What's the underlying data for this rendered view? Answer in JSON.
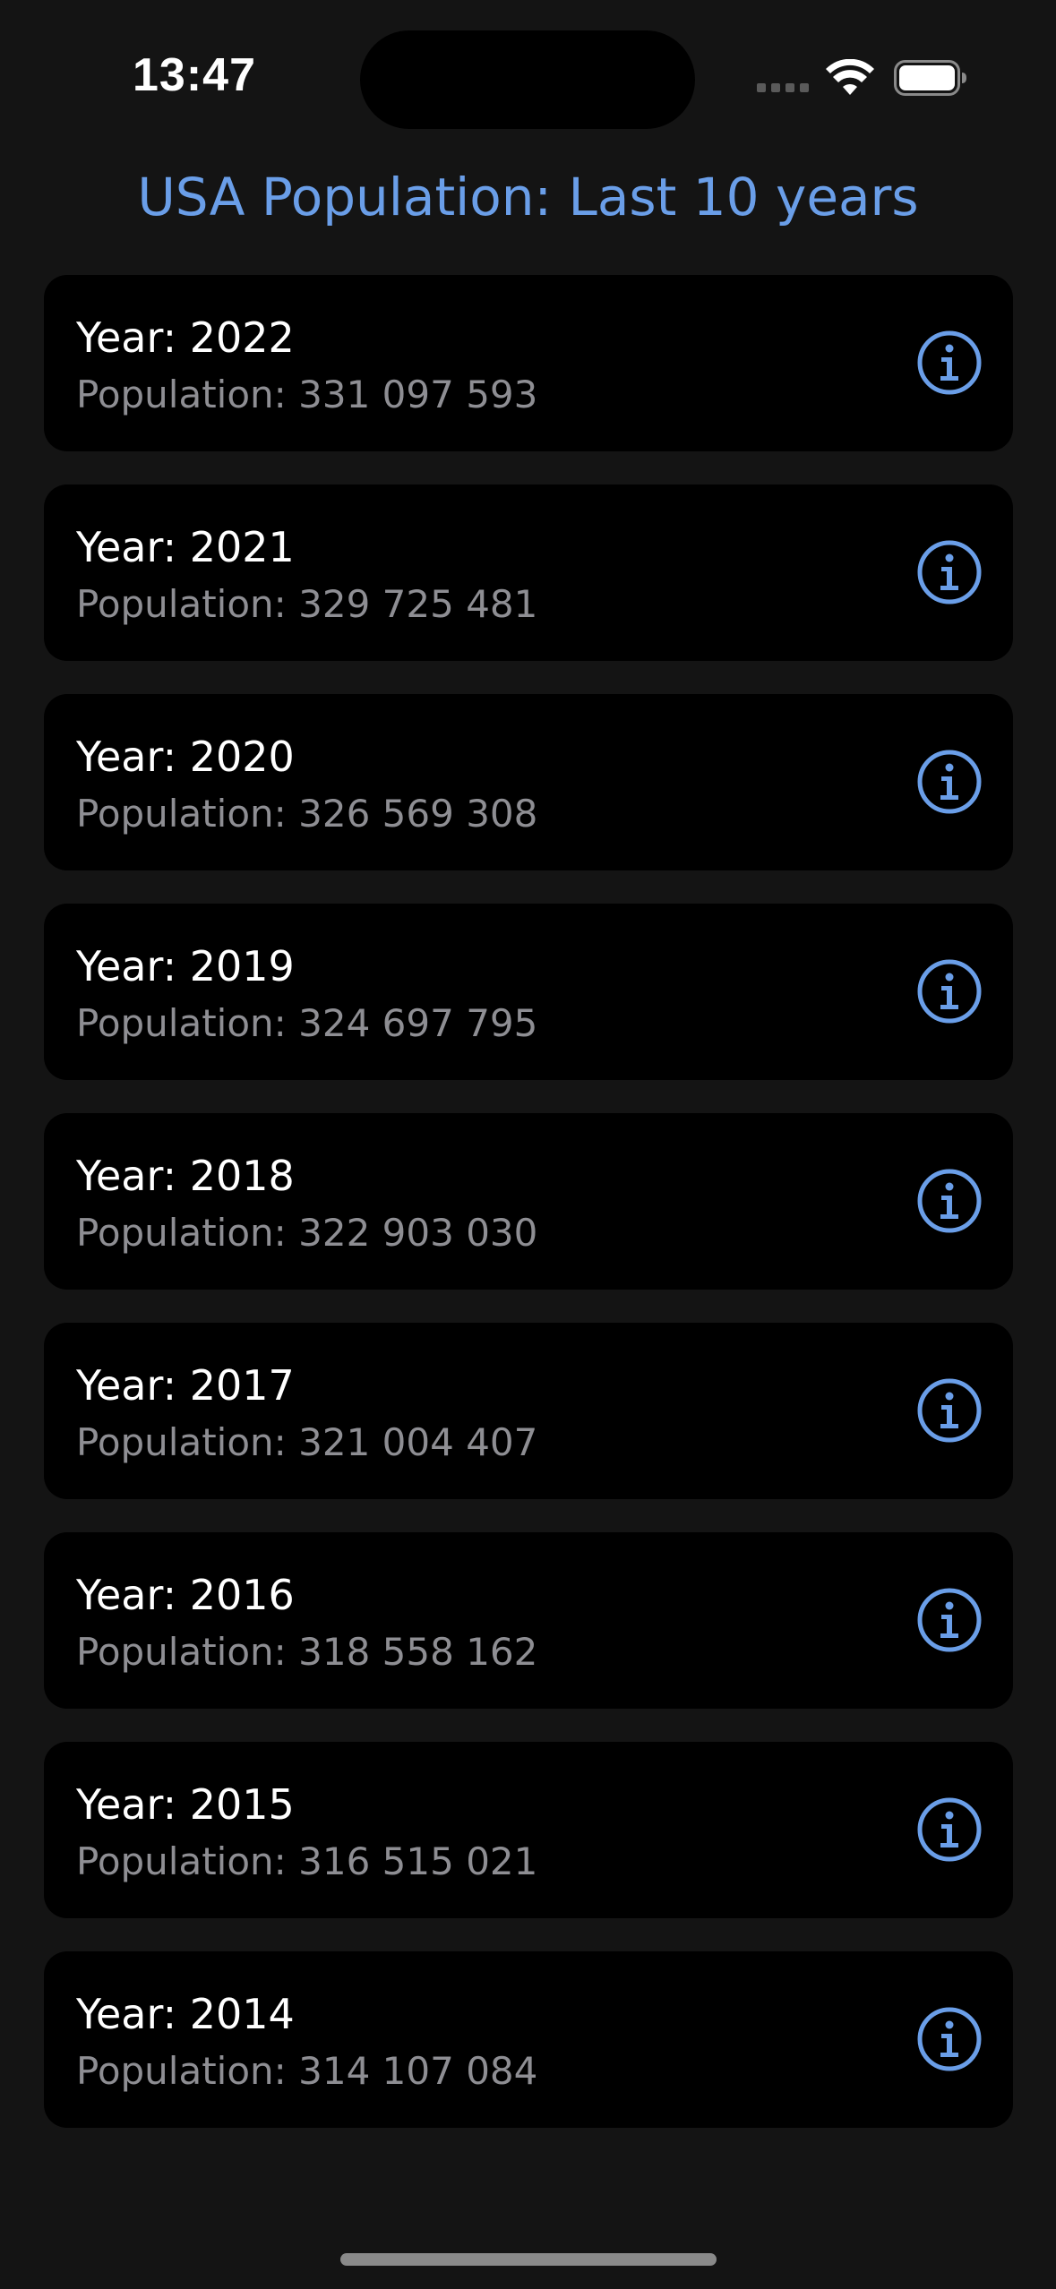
{
  "status_bar": {
    "time": "13:47",
    "icons": [
      "cellular-signal-icon",
      "wifi-icon",
      "battery-icon"
    ]
  },
  "title": "USA Population: Last 10 years",
  "colors": {
    "accent": "#6a9ee8",
    "background": "#141414",
    "card": "#000000",
    "secondary_text": "#8e8e93"
  },
  "items": [
    {
      "year": "Year: 2022",
      "population": "Population: 331 097 593",
      "icon": "info-icon"
    },
    {
      "year": "Year: 2021",
      "population": "Population: 329 725 481",
      "icon": "info-icon"
    },
    {
      "year": "Year: 2020",
      "population": "Population: 326 569 308",
      "icon": "info-icon"
    },
    {
      "year": "Year: 2019",
      "population": "Population: 324 697 795",
      "icon": "info-icon"
    },
    {
      "year": "Year: 2018",
      "population": "Population: 322 903 030",
      "icon": "info-icon"
    },
    {
      "year": "Year: 2017",
      "population": "Population: 321 004 407",
      "icon": "info-icon"
    },
    {
      "year": "Year: 2016",
      "population": "Population: 318 558 162",
      "icon": "info-icon"
    },
    {
      "year": "Year: 2015",
      "population": "Population: 316 515 021",
      "icon": "info-icon"
    },
    {
      "year": "Year: 2014",
      "population": "Population: 314 107 084",
      "icon": "info-icon"
    }
  ]
}
